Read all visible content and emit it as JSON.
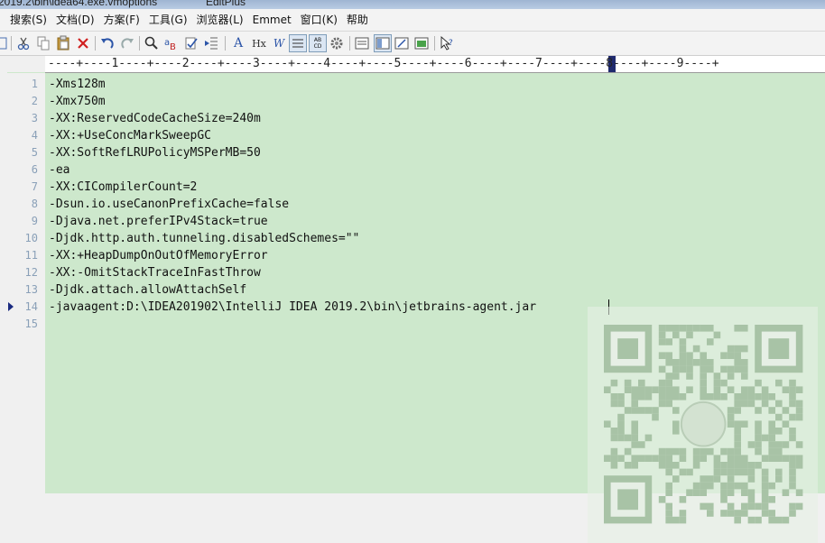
{
  "window": {
    "title_fragment_left": "2019.2\\bin\\idea64.exe.vmoptions",
    "title_fragment_right": "EditPlus"
  },
  "menu": [
    {
      "name": "menu-search",
      "label": "搜索(S)"
    },
    {
      "name": "menu-document",
      "label": "文档(D)"
    },
    {
      "name": "menu-project",
      "label": "方案(F)"
    },
    {
      "name": "menu-tools",
      "label": "工具(G)"
    },
    {
      "name": "menu-browser",
      "label": "浏览器(L)"
    },
    {
      "name": "menu-emmet",
      "label": "Emmet"
    },
    {
      "name": "menu-window",
      "label": "窗口(K)"
    },
    {
      "name": "menu-help",
      "label": "帮助"
    }
  ],
  "toolbar": {
    "font_glyph": "A",
    "hex_label": "Hx",
    "word_wrap_glyph": "W",
    "column_label": "AB CD",
    "help_glyph": "?"
  },
  "ruler": {
    "text": "----+----1----+----2----+----3----+----4----+----5----+----6----+----7----+----8----+----9----+"
  },
  "editor": {
    "current_line": 14,
    "lines": [
      "-Xms128m",
      "-Xmx750m",
      "-XX:ReservedCodeCacheSize=240m",
      "-XX:+UseConcMarkSweepGC",
      "-XX:SoftRefLRUPolicyMSPerMB=50",
      "-ea",
      "-XX:CICompilerCount=2",
      "-Dsun.io.useCanonPrefixCache=false",
      "-Djava.net.preferIPv4Stack=true",
      "-Djdk.http.auth.tunneling.disabledSchemes=\"\"",
      "-XX:+HeapDumpOnOutOfMemoryError",
      "-XX:-OmitStackTraceInFastThrow",
      "-Djdk.attach.allowAttachSelf",
      "-javaagent:D:\\IDEA201902\\IntelliJ IDEA 2019.2\\bin\\jetbrains-agent.jar",
      ""
    ]
  },
  "colors": {
    "editor_background": "#cde8cc",
    "gutter_text": "#8aa0b8",
    "ruler_cursor": "#1f2a6e"
  }
}
